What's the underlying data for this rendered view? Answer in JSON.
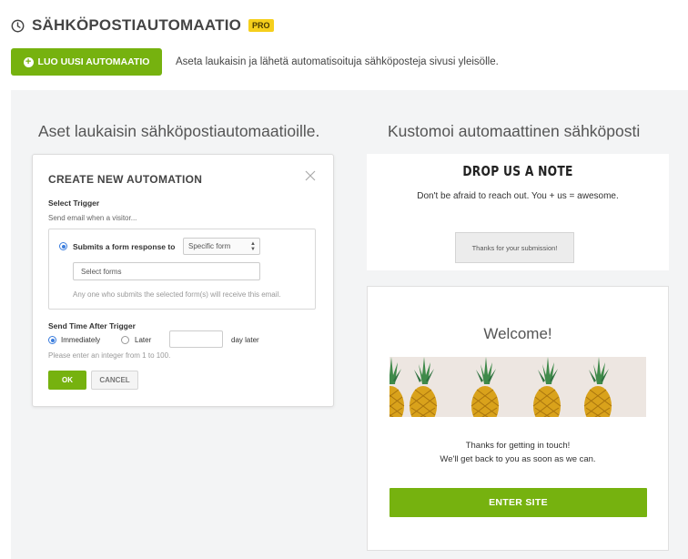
{
  "header": {
    "title": "SÄHKÖPOSTIAUTOMAATIO",
    "badge": "PRO",
    "icon": "clock-icon"
  },
  "toolbar": {
    "create_label": "LUO UUSI AUTOMAATIO",
    "description": "Aseta laukaisin ja lähetä automatisoituja sähköposteja sivusi yleisölle."
  },
  "left_column": {
    "title": "Aset laukaisin sähköpostiautomaatioille.",
    "modal": {
      "title": "CREATE NEW AUTOMATION",
      "select_trigger_label": "Select Trigger",
      "send_when_text": "Send email when a visitor...",
      "trigger_option": "Submits a form response to",
      "trigger_select_value": "Specific form",
      "forms_placeholder": "Select forms",
      "trigger_help": "Any one who submits the selected form(s) will receive this email.",
      "send_time_label": "Send Time After Trigger",
      "immediately_label": "Immediately",
      "later_label": "Later",
      "day_later_label": "day later",
      "integer_hint": "Please enter an integer  from 1 to 100.",
      "ok_label": "OK",
      "cancel_label": "CANCEL"
    }
  },
  "right_column": {
    "title": "Kustomoi automaattinen sähköposti",
    "note_card": {
      "heading": "DROP US A NOTE",
      "subtext": "Don't be afraid to reach out. You + us = awesome.",
      "thanks_text": "Thanks for your submission!"
    },
    "welcome_card": {
      "heading": "Welcome!",
      "line1": "Thanks for getting in touch!",
      "line2": "We'll get back to you as soon as we can.",
      "button_label": "ENTER SITE"
    }
  },
  "colors": {
    "accent_green": "#76b20f",
    "pro_badge": "#f5cf1c",
    "panel_bg": "#f3f4f5",
    "radio_blue": "#3b7ddd"
  }
}
